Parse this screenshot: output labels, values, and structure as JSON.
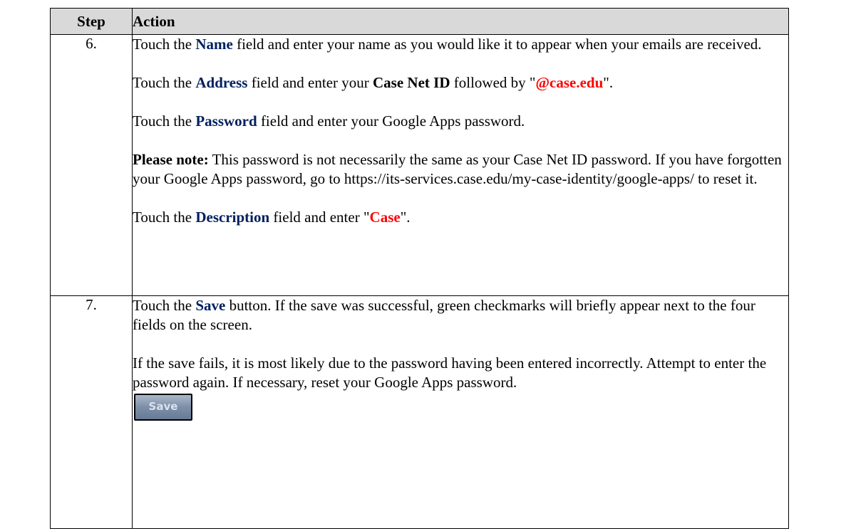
{
  "table": {
    "headers": {
      "step": "Step",
      "action": "Action"
    },
    "rows": [
      {
        "step": "6.",
        "p1": {
          "a": "Touch the ",
          "b": "Name",
          "c": " field and enter your name as you would like it to appear when your emails are received."
        },
        "p2": {
          "a": "Touch the ",
          "b": "Address",
          "c": " field and enter your ",
          "d": "Case Net ID",
          "e": " followed by \"",
          "f": "@case.edu",
          "g": "\"."
        },
        "p3": {
          "a": "Touch the ",
          "b": "Password",
          "c": " field and enter your Google Apps password."
        },
        "p4": {
          "a": "Please note:",
          "b": " This password is not necessarily the same as your Case Net ID password.  If you have forgotten your Google Apps password, go to https://its-services.case.edu/my-case-identity/google-apps/ to reset it."
        },
        "p5": {
          "a": "Touch the ",
          "b": "Description",
          "c": " field and enter \"",
          "d": "Case",
          "e": "\"."
        }
      },
      {
        "step": "7.",
        "p1": {
          "a": "Touch the ",
          "b": "Save",
          "c": " button.  If the save was successful, green checkmarks will briefly appear next to the four fields on the screen."
        },
        "p2": "If the save fails, it is most likely due to the password having been entered incorrectly.  Attempt to enter the password again.  If necessary, reset your Google Apps password.",
        "save_button": "Save"
      }
    ]
  },
  "colors": {
    "field_name": "#002060",
    "keyed_value": "#ff0000",
    "header_bg": "#d9d9d9"
  }
}
